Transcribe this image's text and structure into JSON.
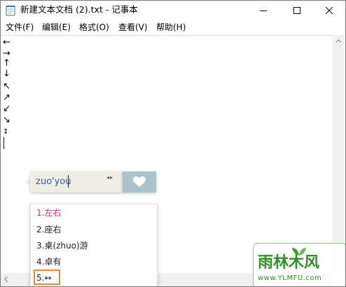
{
  "window": {
    "title": "新建文本文档 (2).txt - 记事本"
  },
  "menu": {
    "items": [
      "文件(F)",
      "编辑(E)",
      "格式(O)",
      "查看(V)",
      "帮助(H)"
    ]
  },
  "editor": {
    "lines": [
      "←",
      "→",
      "↑",
      "↓",
      "↖",
      "↗",
      "↙",
      "↘",
      "↕"
    ]
  },
  "ime": {
    "composition": "zuo'you",
    "page_arrows": "◂▸",
    "candidates": [
      "1.左右",
      "2.座右",
      "3.桌(zhuo)游",
      "4.卓有",
      "5.↔"
    ],
    "selected_index": 0,
    "highlight_color": "#e8873b",
    "selected_color": "#c0326f"
  },
  "watermark": {
    "title": "雨林木风",
    "url": "www.YLMFU.com"
  },
  "icons": {
    "app": "notepad-icon",
    "minimize": "minimize-icon",
    "maximize": "maximize-icon",
    "close": "close-icon",
    "ime_action": "heart-icon"
  }
}
